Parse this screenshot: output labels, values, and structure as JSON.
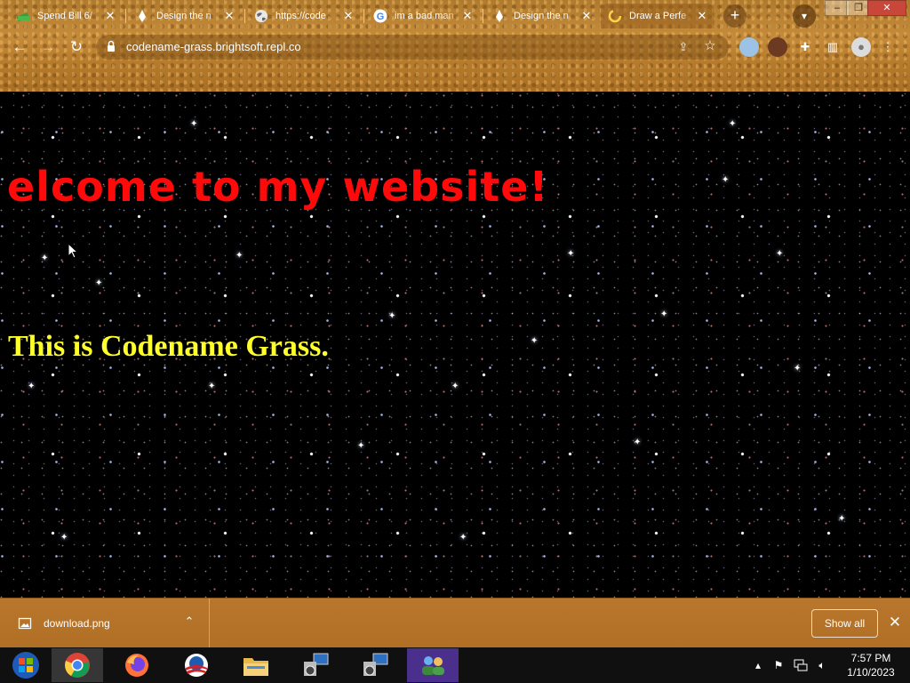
{
  "browser": {
    "tabs": [
      {
        "title": "Spend Bill 6/",
        "icon": "money-stack-icon"
      },
      {
        "title": "Design the n",
        "icon": "pen-nib-icon"
      },
      {
        "title": "https://code",
        "icon": "globe-icon"
      },
      {
        "title": "im a bad man",
        "icon": "google-icon"
      },
      {
        "title": "Design the n",
        "icon": "pen-nib-icon"
      },
      {
        "title": "Draw a Perfe",
        "icon": "loading-spinner-icon"
      }
    ],
    "active_tab_index": 5,
    "url": "codename-grass.brightsoft.repl.co"
  },
  "page": {
    "headline": "elcome to my website!",
    "subline": "This is Codename Grass.",
    "headline_color": "#ff0a0a",
    "subline_color": "#ffff2a",
    "background": "starfield"
  },
  "downloads": {
    "file_name": "download.png",
    "show_all_label": "Show all"
  },
  "taskbar": {
    "apps": [
      "start-button",
      "chrome-icon",
      "firefox-icon",
      "obama-logo-icon",
      "file-explorer-icon",
      "network-setup-icon",
      "network-setup-icon-2",
      "users-icon"
    ],
    "time": "7:57 PM",
    "date": "1/10/2023"
  }
}
